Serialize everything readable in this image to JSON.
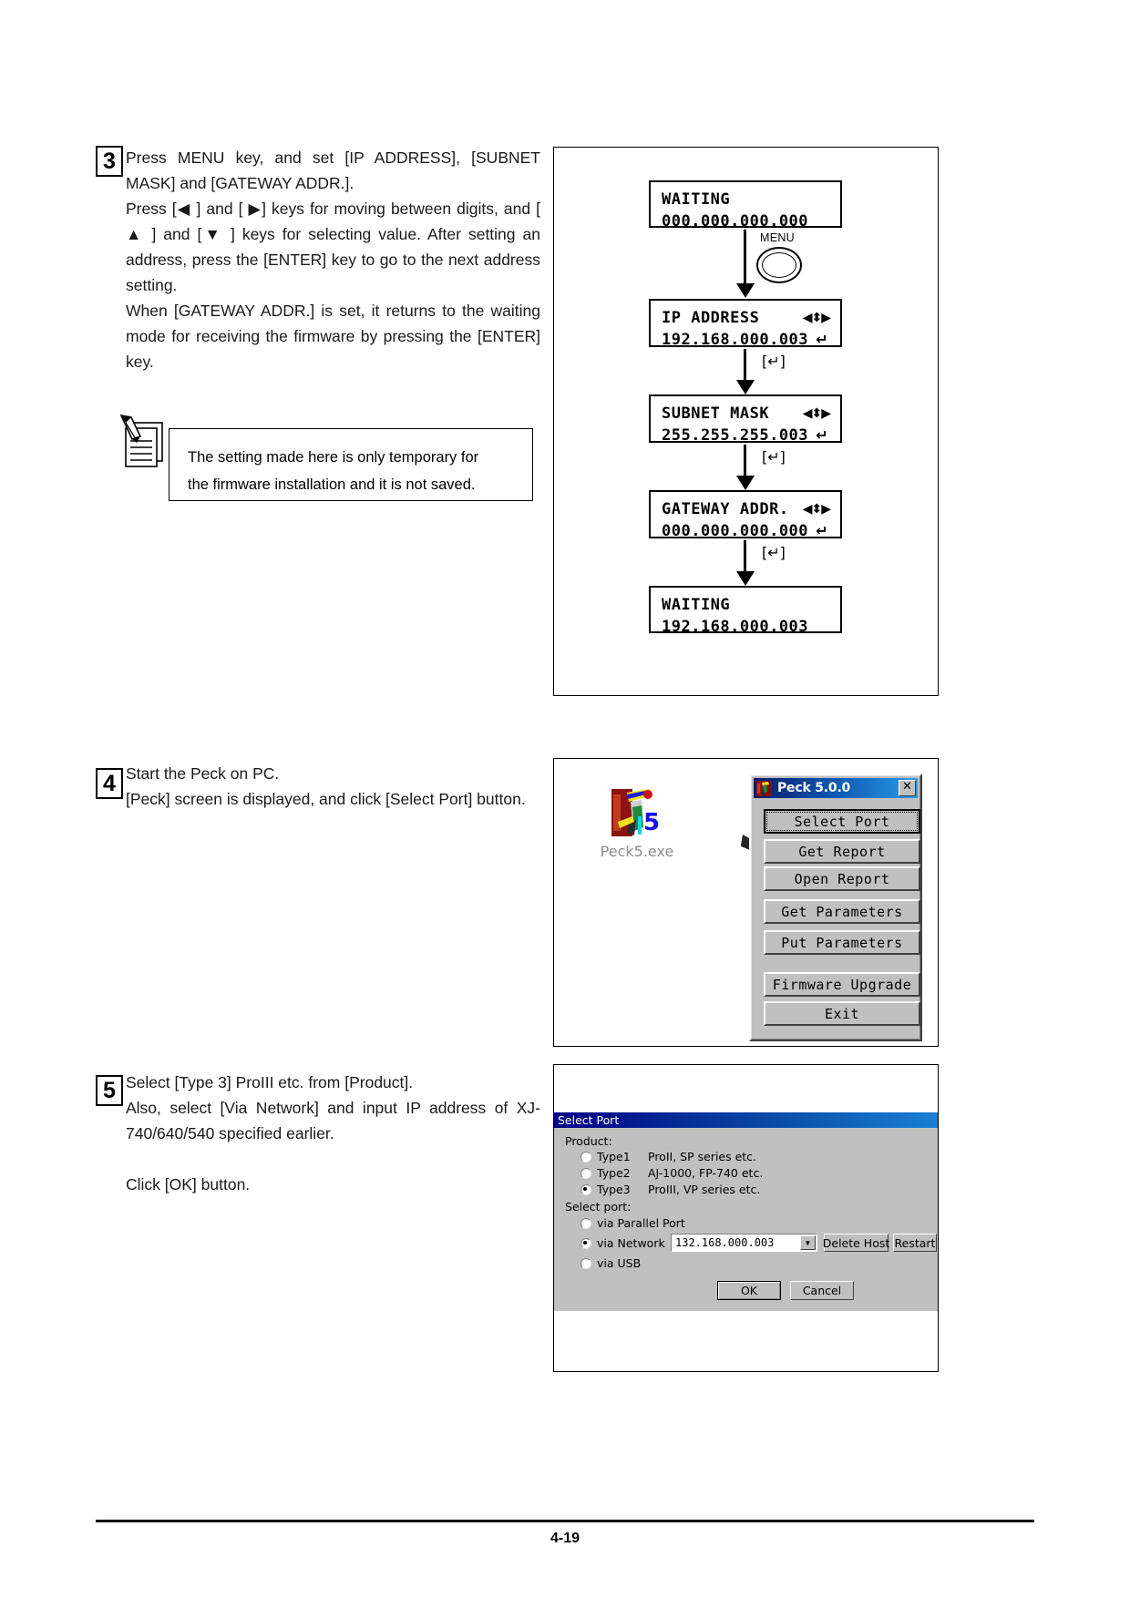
{
  "page": {
    "footer_number": "4-19"
  },
  "steps": [
    {
      "number": "3",
      "lines": [
        "Press MENU key, and set [IP ADDRESS], [SUBNET MASK] and [GATEWAY ADDR.].",
        "Press [◀ ] and [ ▶] keys for moving between digits, and [ ▲ ] and [▼ ] keys for selecting value. After setting an address, press the [ENTER] key to go to the next address setting.",
        "When [GATEWAY ADDR.] is set, it returns to the waiting mode for receiving the firmware by pressing the [ENTER] key."
      ]
    },
    {
      "number": "4",
      "lines": [
        "Start the Peck on PC.",
        "[Peck] screen is displayed, and click [Select Port] button."
      ]
    },
    {
      "number": "5",
      "lines": [
        "Select [Type 3] ProIII etc. from [Product].",
        "Also, select [Via Network] and input IP address of XJ-740/640/540 specified earlier.",
        "Click [OK] button."
      ]
    }
  ],
  "note": {
    "text_line1": "The setting made here is only temporary for",
    "text_line2": "the firmware installation and it is not saved.",
    "icon": "memo-pencil-icon"
  },
  "lcd_flow": {
    "screens": [
      {
        "title": "WAITING",
        "value": "000.000.000.000",
        "nav": "",
        "enter": ""
      },
      {
        "title": "IP ADDRESS",
        "value": "192.168.000.003",
        "nav": "◀⬍▶",
        "enter": "↵"
      },
      {
        "title": "SUBNET MASK",
        "value": "255.255.255.003",
        "nav": "◀⬍▶",
        "enter": "↵"
      },
      {
        "title": "GATEWAY ADDR.",
        "value": "000.000.000.000",
        "nav": "◀⬍▶",
        "enter": "↵"
      },
      {
        "title": "WAITING",
        "value": "192.168.000.003",
        "nav": "",
        "enter": ""
      }
    ],
    "menu_button_label": "MENU",
    "transition_labels": [
      "[↵]",
      "[↵]",
      "[↵]"
    ]
  },
  "desktop": {
    "icon_name": "peck5-exe-icon",
    "icon_label": "Peck5.exe",
    "arrow_name": "pointing-arrow"
  },
  "peck_window": {
    "title": "Peck 5.0.0",
    "close_label": "✕",
    "buttons": [
      {
        "label": "Select Port",
        "focused": true
      },
      {
        "label": "Get Report",
        "focused": false
      },
      {
        "label": "Open Report",
        "focused": false
      },
      {
        "label": "Get Parameters",
        "focused": false
      },
      {
        "label": "Put Parameters",
        "focused": false
      },
      {
        "label": "Firmware Upgrade",
        "focused": false
      },
      {
        "label": "Exit",
        "focused": false
      }
    ]
  },
  "select_port_dialog": {
    "title": "Select Port",
    "product_group_label": "Product:",
    "product_options": [
      {
        "label": "Type1",
        "desc": "ProII, SP series etc.",
        "checked": false
      },
      {
        "label": "Type2",
        "desc": "AJ-1000, FP-740 etc.",
        "checked": false
      },
      {
        "label": "Type3",
        "desc": "ProIII, VP series etc.",
        "checked": true
      }
    ],
    "port_group_label": "Select port:",
    "port_options": [
      {
        "label": "via Parallel Port",
        "checked": false
      },
      {
        "label": "via Network",
        "checked": true
      },
      {
        "label": "via USB",
        "checked": false
      }
    ],
    "network_value": "132.168.000.003",
    "delete_host_label": "Delete Host",
    "restart_label": "Restart",
    "ok_label": "OK",
    "cancel_label": "Cancel"
  },
  "colors": {
    "titlebar_start": "#000083",
    "titlebar_end": "#1a7fd4",
    "dialog_face": "#c0c0c0",
    "text": "#000000"
  }
}
